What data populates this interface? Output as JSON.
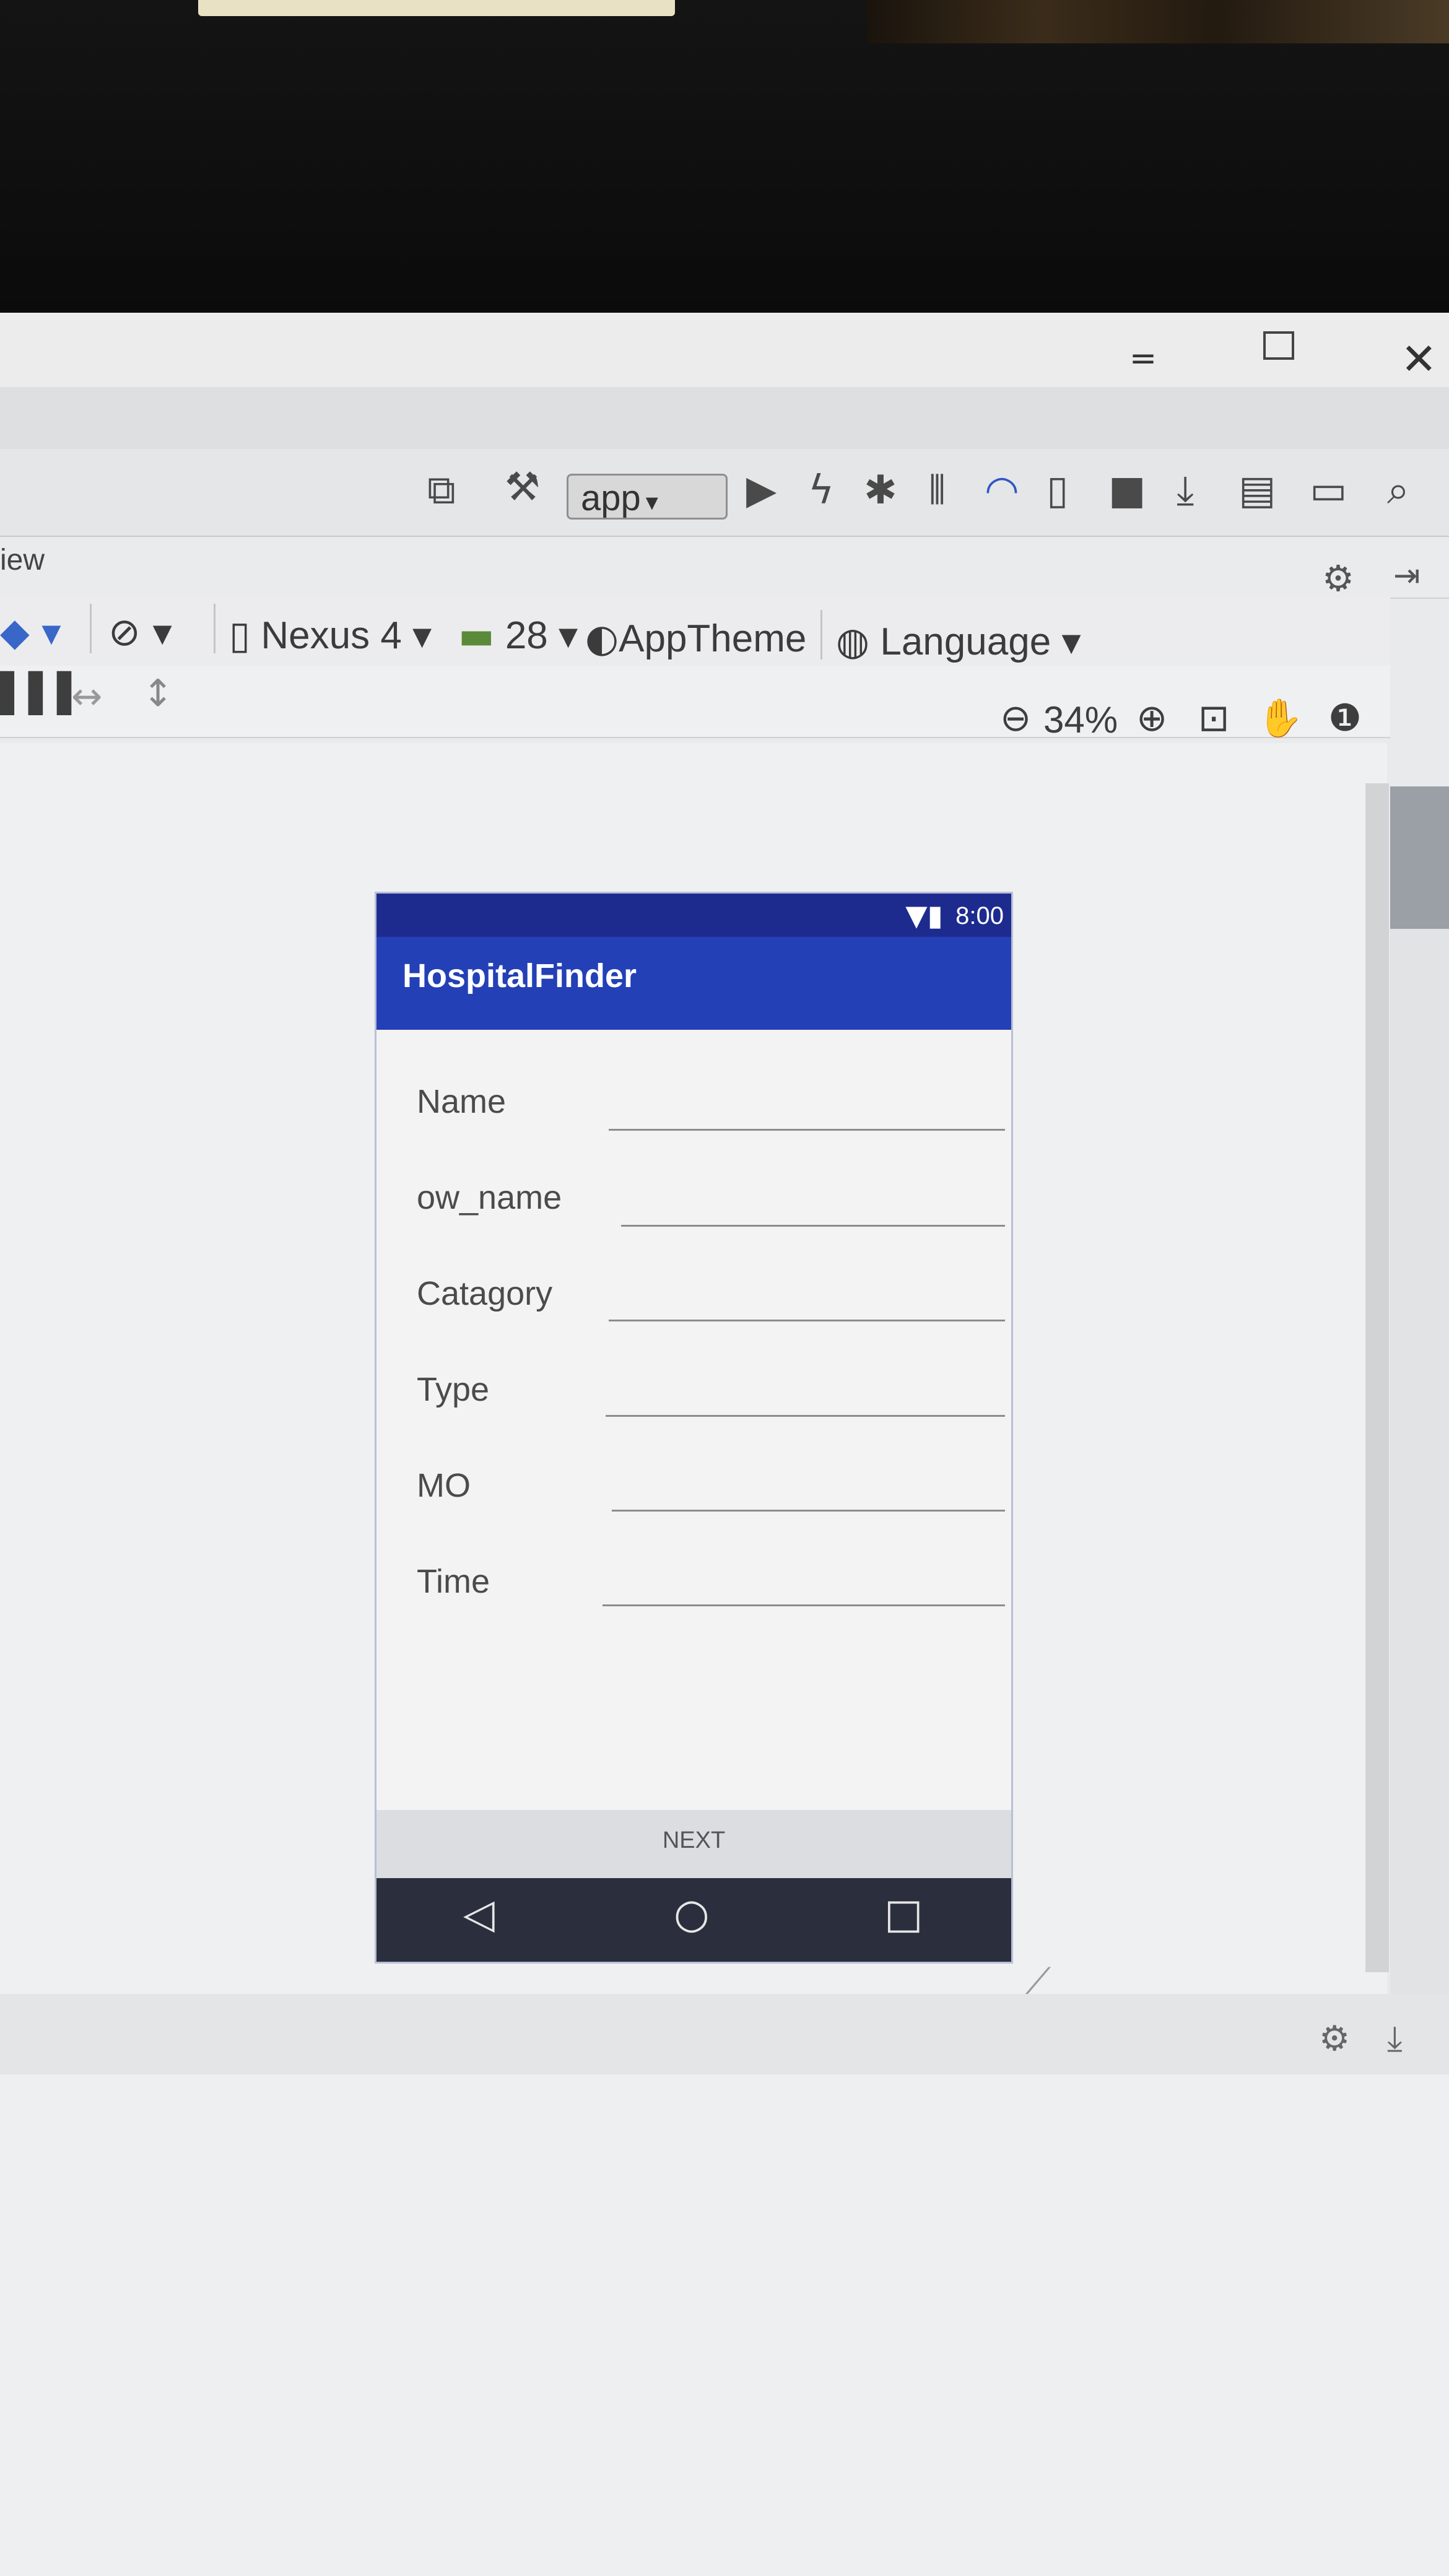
{
  "window": {
    "minimize_icon": "minimize-icon",
    "maximize_icon": "maximize-icon",
    "close_icon": "close-icon",
    "close_glyph": "✕"
  },
  "toolbar": {
    "run_config": "app",
    "icons": [
      "screen-icon",
      "build-hammer-icon",
      "run-icon",
      "apply-changes-icon",
      "debug-icon",
      "attach-icon",
      "profile-icon",
      "device-icon",
      "stop-icon",
      "sdk-icon",
      "avd-icon",
      "project-structure-icon",
      "search-icon"
    ]
  },
  "panel": {
    "title": "iew"
  },
  "design_toolbar": {
    "device": "Nexus 4",
    "api_level": "28",
    "theme": "AppTheme",
    "language": "Language"
  },
  "zoom": {
    "level": "34%"
  },
  "phone": {
    "status_time": "8:00",
    "app_title": "HospitalFinder",
    "fields": [
      {
        "label": "Name"
      },
      {
        "label": "ow_name"
      },
      {
        "label": "Catagory"
      },
      {
        "label": "Type"
      },
      {
        "label": "MO"
      },
      {
        "label": "Time"
      }
    ],
    "next_button": "NEXT"
  },
  "colors": {
    "app_bar": "#2340b6",
    "status_bar": "#1d2b8f",
    "nav_bar": "#2b2f3d"
  }
}
